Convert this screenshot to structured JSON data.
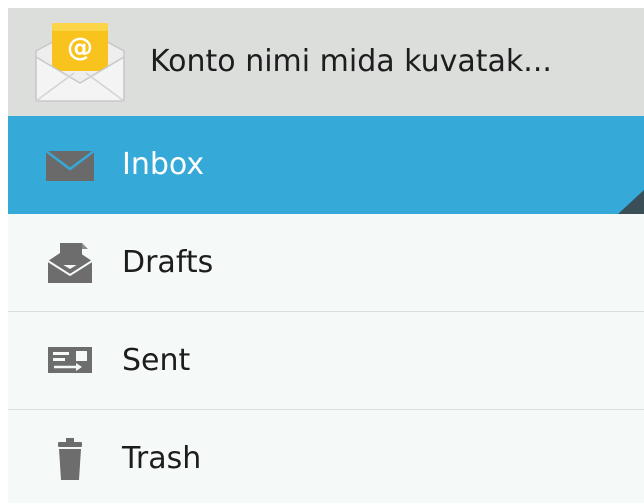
{
  "account": {
    "name": "Konto nimi mida kuvatak...",
    "icon": "email-envelope-icon",
    "icon_badge": "@"
  },
  "nav": {
    "items": [
      {
        "label": "Inbox",
        "icon": "envelope-icon",
        "selected": true
      },
      {
        "label": "Drafts",
        "icon": "drafts-icon",
        "selected": false
      },
      {
        "label": "Sent",
        "icon": "sent-icon",
        "selected": false
      },
      {
        "label": "Trash",
        "icon": "trash-icon",
        "selected": false
      }
    ]
  },
  "colors": {
    "selected_background": "#35a9d8",
    "header_background": "#dcdedc",
    "list_background": "#f5f9f7",
    "icon_gray": "#6d6d6d"
  }
}
